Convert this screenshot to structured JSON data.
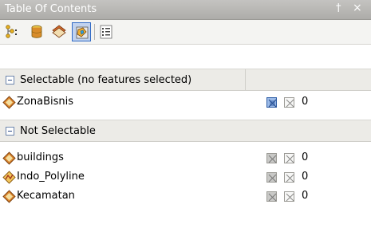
{
  "window": {
    "title": "Table Of Contents",
    "pin_glyph": "†",
    "close_glyph": "×"
  },
  "toolbar": {
    "buttons": [
      {
        "icon": "list-by-drawing-order-icon"
      },
      {
        "icon": "list-by-source-icon"
      },
      {
        "icon": "list-by-visibility-icon"
      },
      {
        "icon": "list-by-selection-icon",
        "active": true
      },
      {
        "icon": "options-icon"
      }
    ]
  },
  "groups": [
    {
      "label": "Selectable (no features selected)",
      "layers": [
        {
          "name": "ZonaBisnis",
          "count": "0",
          "selectable": true
        }
      ]
    },
    {
      "label": "Not Selectable",
      "layers": [
        {
          "name": "buildings",
          "count": "0",
          "selectable": false
        },
        {
          "name": "Indo_Polyline",
          "count": "0",
          "selectable": false
        },
        {
          "name": "Kecamatan",
          "count": "0",
          "selectable": false
        }
      ]
    }
  ],
  "colors": {
    "title_bar": "#adaca9",
    "group_header": "#ecebe7",
    "selection_blue": "#316ac5"
  }
}
